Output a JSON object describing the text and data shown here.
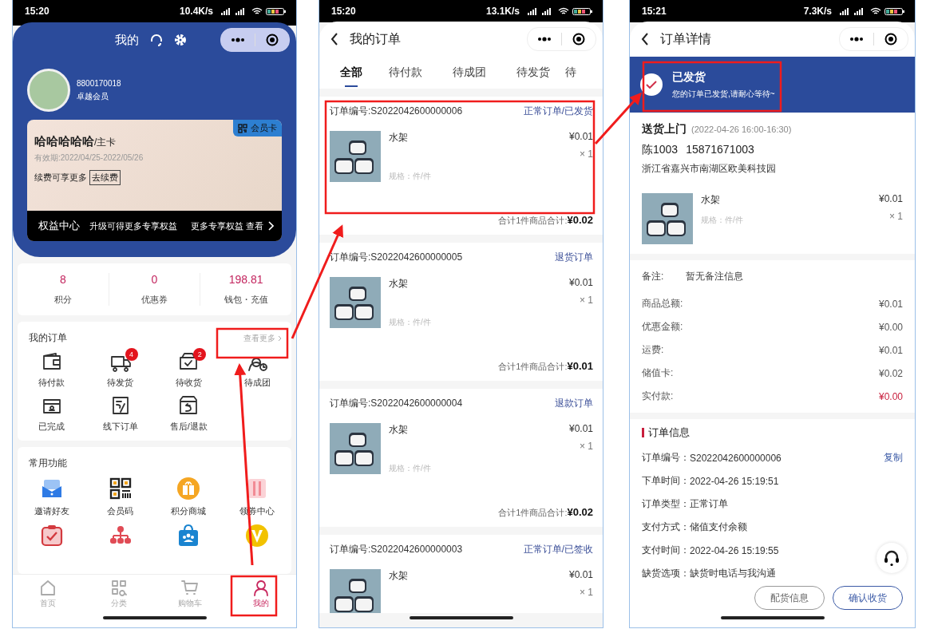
{
  "home_screen": {
    "status_bar": {
      "time": "15:20",
      "speed": "10.4K/s"
    },
    "title": "我的",
    "profile": {
      "account": "8800170018",
      "level": "卓越会员"
    },
    "member_card": {
      "name": "**哈哈哈哈哈**/主卡",
      "badge": "会员卡",
      "validity": "有效期:2022/04/25-2022/05/26",
      "renew_text": "续费可享更多",
      "renew_button": "去续费",
      "bar_title": "权益中心",
      "bar_text": "升级可得更多专享权益",
      "bar_link": "更多专享权益 查看"
    },
    "stats": [
      {
        "value": "8",
        "label": "积分"
      },
      {
        "value": "0",
        "label": "优惠券"
      },
      {
        "value": "198.81",
        "label": "钱包・充值"
      }
    ],
    "orders_section": {
      "title": "我的订单",
      "more": "查看更多",
      "items": [
        {
          "label": "待付款",
          "kind": "wallet"
        },
        {
          "label": "待发货",
          "kind": "truck",
          "badge": "4"
        },
        {
          "label": "待收货",
          "kind": "box",
          "badge": "2"
        },
        {
          "label": "待成团",
          "kind": "group"
        },
        {
          "label": "已完成",
          "kind": "done"
        },
        {
          "label": "线下订单",
          "kind": "note"
        },
        {
          "label": "售后/退款",
          "kind": "return"
        }
      ]
    },
    "features": {
      "title": "常用功能",
      "items": [
        {
          "label": "邀请好友",
          "kind": "invite"
        },
        {
          "label": "会员码",
          "kind": "qr"
        },
        {
          "label": "积分商城",
          "kind": "gift"
        },
        {
          "label": "领券中心",
          "kind": "coupon"
        },
        {
          "kind": "calendar"
        },
        {
          "kind": "org"
        },
        {
          "kind": "bag"
        },
        {
          "kind": "vip"
        }
      ]
    },
    "tab_bar": [
      {
        "label": "首页",
        "kind": "home",
        "selected": false
      },
      {
        "label": "分类",
        "kind": "grid",
        "selected": false
      },
      {
        "label": "购物车",
        "kind": "cart",
        "selected": false
      },
      {
        "label": "我的",
        "kind": "user",
        "selected": true
      }
    ]
  },
  "orders_screen": {
    "status_bar": {
      "time": "15:20",
      "speed": "13.1K/s"
    },
    "title": "我的订单",
    "tabs": [
      {
        "label": "全部",
        "selected": true
      },
      {
        "label": "待付款",
        "selected": false
      },
      {
        "label": "待成团",
        "selected": false
      },
      {
        "label": "待发货",
        "selected": false
      },
      {
        "label": "待",
        "selected": false
      }
    ],
    "orders": [
      {
        "number": "订单编号:S2022042600000006",
        "status": "正常订单/已发货",
        "item": "水架",
        "spec": "规格：件/件",
        "price": "¥0.01",
        "qty": "× 1",
        "summary": "合计1件商品合计:**¥0.02**"
      },
      {
        "number": "订单编号:S2022042600000005",
        "status": "退货订单",
        "item": "水架",
        "spec": "规格：件/件",
        "price": "¥0.01",
        "qty": "× 1",
        "summary": "合计1件商品合计:**¥0.01**"
      },
      {
        "number": "订单编号:S2022042600000004",
        "status": "退款订单",
        "item": "水架",
        "spec": "规格：件/件",
        "price": "¥0.01",
        "qty": "× 1",
        "summary": "合计1件商品合计:**¥0.02**"
      },
      {
        "number": "订单编号:S2022042600000003",
        "status": "正常订单/已签收",
        "item": "水架",
        "price": "¥0.01",
        "qty": "× 1"
      }
    ]
  },
  "detail_screen": {
    "status_bar": {
      "time": "15:21",
      "speed": "7.3K/s"
    },
    "title": "订单详情",
    "status": {
      "title": "已发货",
      "message": "您的订单已发货,请耐心等待~"
    },
    "delivery": {
      "method": "送货上门",
      "slot": "(2022-04-26 16:00-16:30)",
      "name": "陈1003",
      "phone": "15871671003",
      "address": "浙江省嘉兴市南湖区欧美科技园"
    },
    "item": {
      "name": "水架",
      "spec": "规格：件/件",
      "price": "¥0.01",
      "qty": "× 1"
    },
    "remark": {
      "label": "备注:",
      "value": "暂无备注信息"
    },
    "amounts": [
      {
        "label": "商品总额:",
        "value": "¥0.01",
        "kind": "line"
      },
      {
        "label": "优惠金额:",
        "value": "¥0.00",
        "kind": "line"
      },
      {
        "label": "运费:",
        "value": "¥0.01",
        "kind": "line"
      },
      {
        "label": "储值卡:",
        "value": "¥0.02",
        "kind": "line"
      },
      {
        "label": "实付款:",
        "value": "¥0.00",
        "kind": "due"
      }
    ],
    "info": {
      "title": "订单信息",
      "rows": [
        {
          "label": "订单编号：",
          "value": "S2022042600000006",
          "action": "复制"
        },
        {
          "label": "下单时间：",
          "value": "2022-04-26 15:19:51"
        },
        {
          "label": "订单类型：",
          "value": "正常订单"
        },
        {
          "label": "支付方式：",
          "value": "储值支付余额"
        },
        {
          "label": "支付时间：",
          "value": "2022-04-26 15:19:55"
        },
        {
          "label": "缺货选项：",
          "value": "缺货时电话与我沟通"
        }
      ]
    },
    "buttons": [
      {
        "label": "配货信息",
        "kind": "secondary"
      },
      {
        "label": "确认收货",
        "kind": "primary"
      }
    ]
  }
}
